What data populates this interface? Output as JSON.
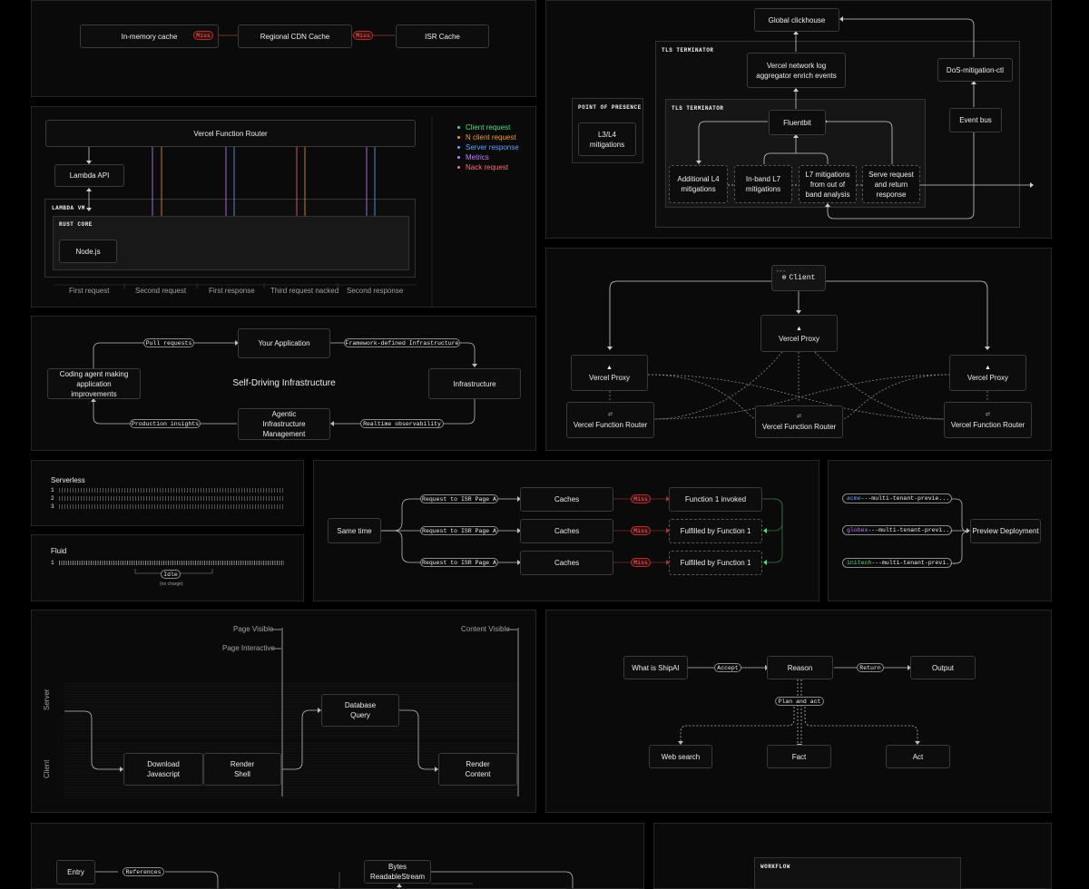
{
  "cache": {
    "boxes": [
      "In-memory cache",
      "Regional CDN Cache",
      "ISR Cache"
    ],
    "miss": "Miss"
  },
  "router": {
    "title": "Vercel Function Router",
    "lambda_api": "Lambda API",
    "lambda_vm": "LAMBDA VM",
    "rust_core": "RUST CORE",
    "nodejs": "Node.js",
    "timeline": [
      "First request",
      "Second request",
      "First response",
      "Third request nacked",
      "Second response"
    ],
    "legend": [
      {
        "label": "Client request",
        "color": "#4ade80"
      },
      {
        "label": "N client request",
        "color": "#f59e0b"
      },
      {
        "label": "Server response",
        "color": "#60a5fa"
      },
      {
        "label": "Metrics",
        "color": "#c084fc"
      },
      {
        "label": "Nack request",
        "color": "#f87171"
      }
    ]
  },
  "selfdriving": {
    "title": "Self-Driving Infrastructure",
    "your_app": "Your Application",
    "infra": "Infrastructure",
    "agentic": "Agentic Infrastructure Management",
    "coding": "Coding agent making application improvements",
    "pills": [
      "Pull requests",
      "Framework-defined Infrastructure",
      "Realtime observability",
      "Production insights"
    ]
  },
  "tls": {
    "clickhouse": "Global clickhouse",
    "tls_outer": "TLS TERMINATOR",
    "tls_inner": "TLS TERMINATOR",
    "log_agg": "Vercel network log aggregator enrich events",
    "dos": "DoS-mitigation-ctl",
    "event_bus": "Event bus",
    "pop": "POINT OF PRESENCE",
    "l3l4": "L3/L4 mitigations",
    "fluentbit": "Fluentbit",
    "mitigations": [
      "Additional L4 mitigations",
      "In-band L7 mitigations",
      "L7 mitigations from out of band analysis",
      "Serve request and return response"
    ]
  },
  "proxy": {
    "client": "Client",
    "central_proxy": "Vercel Proxy",
    "left_proxy": "Vercel Proxy",
    "right_proxy": "Vercel Proxy",
    "routers": [
      "Vercel Function Router",
      "Vercel Function Router",
      "Vercel Function Router"
    ]
  },
  "serverless": {
    "title": "Serverless",
    "rows": [
      "1",
      "2",
      "3"
    ]
  },
  "fluid": {
    "title": "Fluid",
    "row": "1",
    "idle": "Idle",
    "no_charge": "(no charge)"
  },
  "isr": {
    "same_time": "Same time",
    "request": "Request to ISR Page A",
    "caches": "Caches",
    "miss": "Miss",
    "results": [
      "Function 1 invoked",
      "Fulfilled by Function 1",
      "Fulfilled by Function 1"
    ]
  },
  "preview": {
    "tenants": [
      {
        "prefix": "acme",
        "rest": "---multi-tenant-previe...",
        "color": "#60a5fa"
      },
      {
        "prefix": "globex",
        "rest": "---multi-tenant-previ...",
        "color": "#c084fc"
      },
      {
        "prefix": "initech",
        "rest": "---multi-tenant-previ...",
        "color": "#4ade80"
      }
    ],
    "deployment": "Preview Deployment"
  },
  "rendering": {
    "page_visible": "Page Visible",
    "page_interactive": "Page Interactive",
    "content_visible": "Content Visible",
    "server": "Server",
    "client": "Client",
    "download": "Download Javascript",
    "render_shell": "Render Shell",
    "db_query": "Database Query",
    "render_content": "Render Content"
  },
  "shipai": {
    "what": "What is ShipAI",
    "accept": "Accept",
    "reason": "Reason",
    "return": "Return",
    "output": "Output",
    "plan": "Plan and act",
    "tools": [
      "Web search",
      "Fact",
      "Act"
    ]
  },
  "stream": {
    "entry": "Entry",
    "references": "References",
    "bytes": "Bytes ReadableStream"
  },
  "workflow": {
    "label": "WORKFLOW"
  }
}
